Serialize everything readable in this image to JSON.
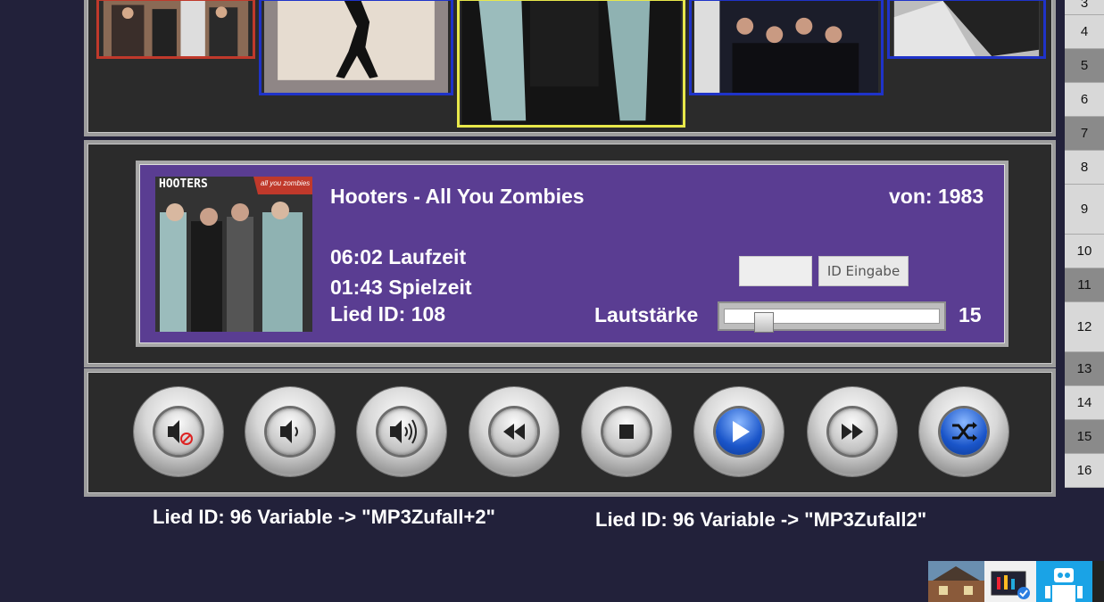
{
  "numbers": [
    "3",
    "4",
    "5",
    "6",
    "7",
    "8",
    "9",
    "10",
    "11",
    "12",
    "13",
    "14",
    "15",
    "16"
  ],
  "track": {
    "title": "Hooters - All You Zombies",
    "year_label": "von: 1983",
    "duration_label": "06:02 Laufzeit",
    "elapsed_label": "01:43 Spielzeit",
    "song_id_label": "Lied ID: 108",
    "art_band": "HOOTERS",
    "art_title": "all you zombies"
  },
  "id_input": {
    "value": "",
    "button_label": "ID Eingabe"
  },
  "volume": {
    "label": "Lautstärke",
    "value": "15",
    "level": 0.15
  },
  "controls": [
    "mute",
    "volume-down",
    "volume-up",
    "rewind",
    "stop",
    "play",
    "fast-forward",
    "shuffle"
  ],
  "captions": {
    "left": "Lied ID: 96 Variable -> \"MP3Zufall+2\"",
    "right": "Lied ID: 96 Variable -> \"MP3Zufall2\""
  },
  "colors": {
    "panel_purple": "#5a3d92",
    "page_bg": "#22213a",
    "play_blue": "#1a55c9"
  },
  "covers": [
    {
      "border": "#c0392b"
    },
    {
      "border": "#1f33c9"
    },
    {
      "border": "#e8e84a"
    },
    {
      "border": "#1f33c9"
    },
    {
      "border": "#1f33c9"
    }
  ]
}
